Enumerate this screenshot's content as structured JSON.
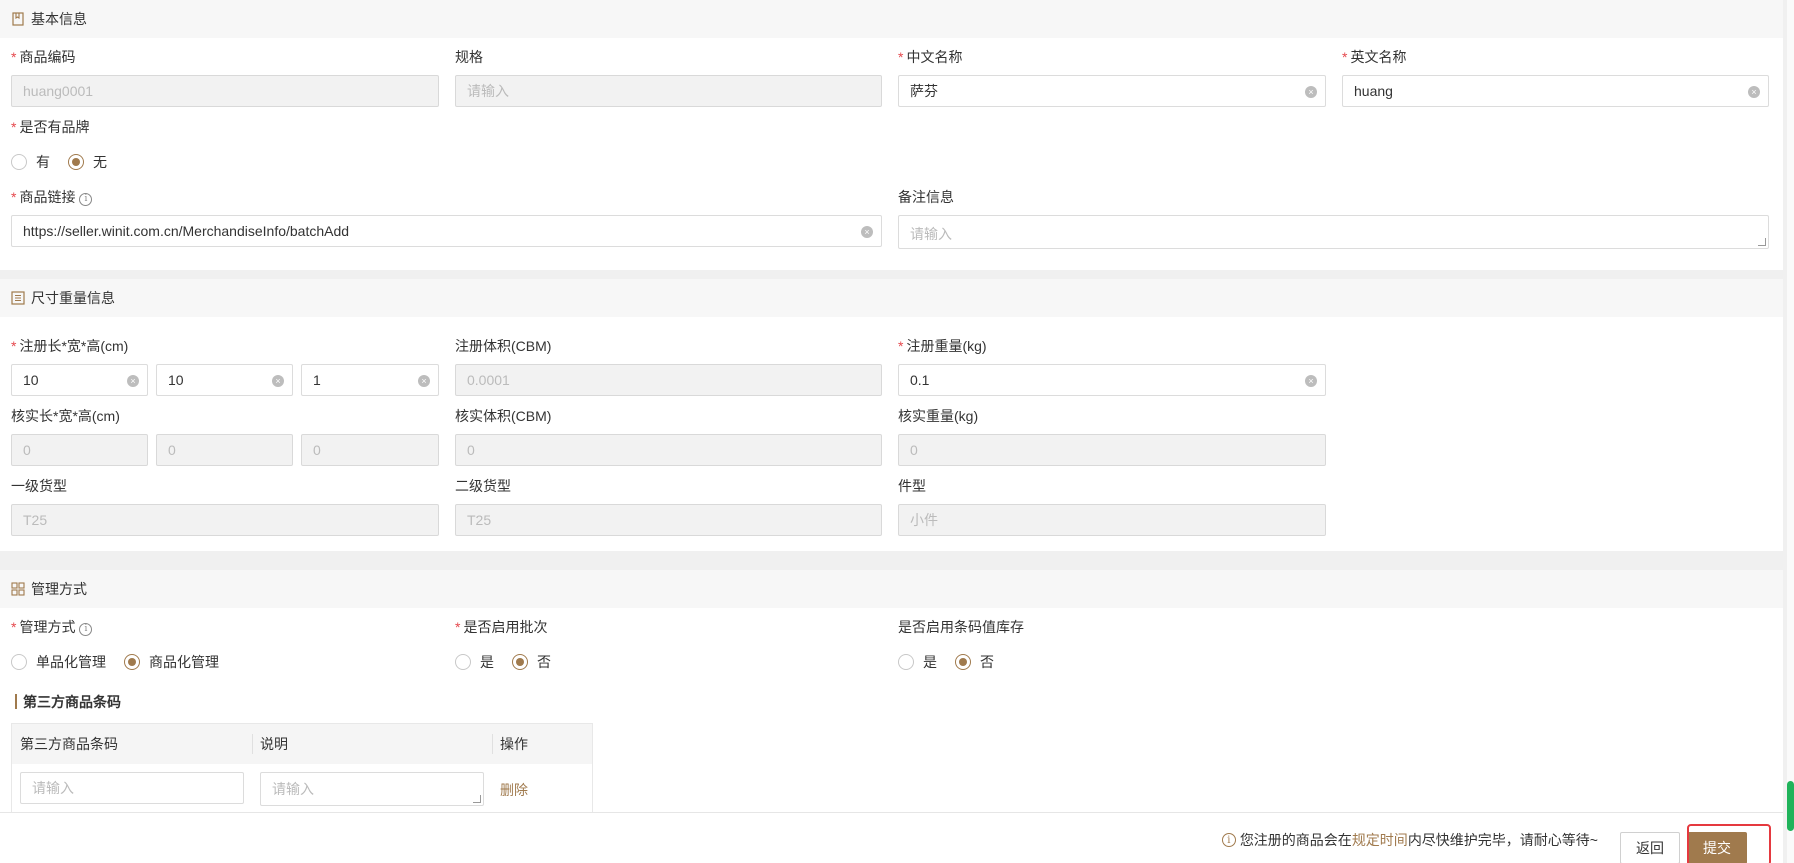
{
  "basic": {
    "section_title": "基本信息",
    "code": {
      "label": "商品编码",
      "value": "huang0001"
    },
    "spec": {
      "label": "规格",
      "placeholder": "请输入"
    },
    "cn_name": {
      "label": "中文名称",
      "value": "萨芬"
    },
    "en_name": {
      "label": "英文名称",
      "value": "huang"
    },
    "brand": {
      "label": "是否有品牌",
      "options": [
        "有",
        "无"
      ],
      "selected": "无"
    },
    "link": {
      "label": "商品链接",
      "value": "https://seller.winit.com.cn/MerchandiseInfo/batchAdd"
    },
    "remark": {
      "label": "备注信息",
      "placeholder": "请输入"
    }
  },
  "size": {
    "section_title": "尺寸重量信息",
    "reg_dims": {
      "label": "注册长*宽*高(cm)",
      "values": [
        "10",
        "10",
        "1"
      ]
    },
    "reg_volume": {
      "label": "注册体积(CBM)",
      "value": "0.0001"
    },
    "reg_weight": {
      "label": "注册重量(kg)",
      "value": "0.1"
    },
    "ver_dims": {
      "label": "核实长*宽*高(cm)",
      "values": [
        "0",
        "0",
        "0"
      ]
    },
    "ver_volume": {
      "label": "核实体积(CBM)",
      "value": "0"
    },
    "ver_weight": {
      "label": "核实重量(kg)",
      "value": "0"
    },
    "cargo1": {
      "label": "一级货型",
      "value": "T25"
    },
    "cargo2": {
      "label": "二级货型",
      "value": "T25"
    },
    "piece": {
      "label": "件型",
      "value": "小件"
    }
  },
  "manage": {
    "section_title": "管理方式",
    "mode": {
      "label": "管理方式",
      "options": [
        "单品化管理",
        "商品化管理"
      ],
      "selected": "商品化管理"
    },
    "batch": {
      "label": "是否启用批次",
      "options": [
        "是",
        "否"
      ],
      "selected": "否"
    },
    "barcode_stock": {
      "label": "是否启用条码值库存",
      "options": [
        "是",
        "否"
      ],
      "selected": "否"
    },
    "third_title": "第三方商品条码",
    "table": {
      "columns": [
        "第三方商品条码",
        "说明",
        "操作"
      ],
      "row": {
        "barcode_placeholder": "请输入",
        "desc_placeholder": "请输入",
        "action": "删除"
      }
    }
  },
  "footer": {
    "notice_pre": "您注册的商品会在",
    "notice_hl": "规定时间",
    "notice_post": "内尽快维护完毕，请耐心等待~",
    "back": "返回",
    "submit": "提交"
  },
  "colors": {
    "accent": "#a07a4d",
    "required": "#e5484d",
    "highlight": "#e5393f"
  }
}
